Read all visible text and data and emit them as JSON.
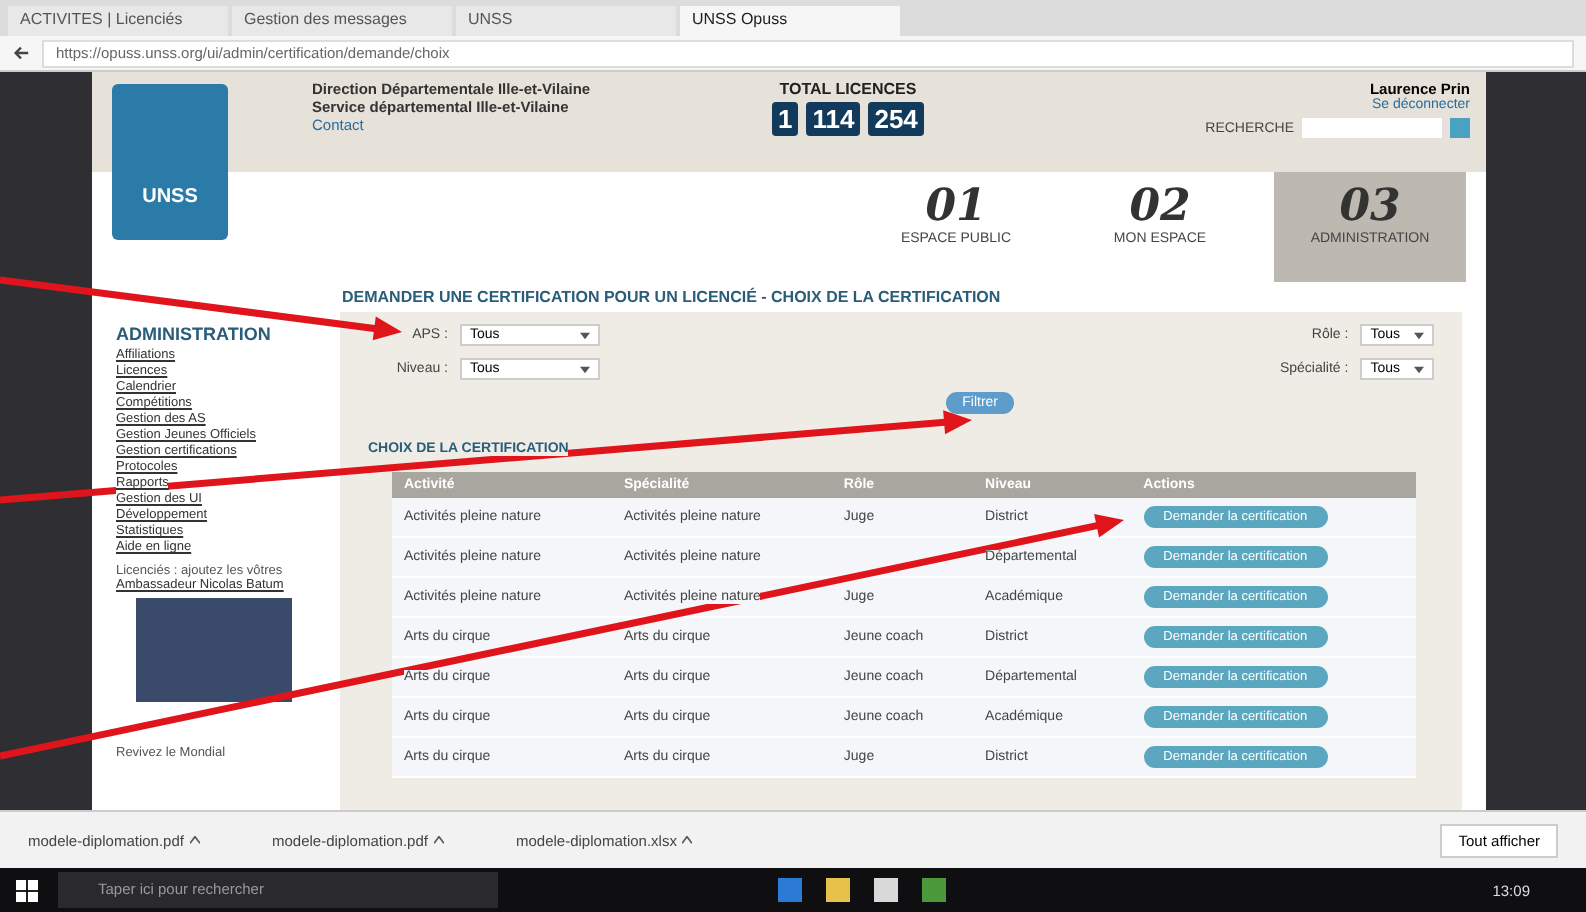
{
  "browser": {
    "tabs": [
      {
        "label": "ACTIVITES | Licenciés",
        "selected": false
      },
      {
        "label": "Gestion des messages",
        "selected": false
      },
      {
        "label": "UNSS",
        "selected": false
      },
      {
        "label": "UNSS Opuss",
        "selected": true
      }
    ],
    "url": "https://opuss.unss.org/ui/admin/certification/demande/choix"
  },
  "header": {
    "lines": [
      "Direction Départementale Ille-et-Vilaine",
      "Service départemental Ille-et-Vilaine",
      "Contact"
    ],
    "logo": "UNSS",
    "total_label": "TOTAL LICENCES",
    "total_digits": [
      "1",
      "114",
      "254"
    ],
    "user": "Laurence Prin",
    "logout": "Se déconnecter",
    "search_label": "RECHERCHE"
  },
  "spaces": [
    {
      "number": "01",
      "label": "ESPACE PUBLIC",
      "selected": false
    },
    {
      "number": "02",
      "label": "MON ESPACE",
      "selected": false
    },
    {
      "number": "03",
      "label": "ADMINISTRATION",
      "selected": true
    }
  ],
  "page_title": "DEMANDER UNE CERTIFICATION POUR UN LICENCIÉ - CHOIX DE LA CERTIFICATION",
  "sidebar": {
    "title": "ADMINISTRATION",
    "items": [
      "Affiliations",
      "Licences",
      "Calendrier",
      "Compétitions",
      "Gestion des AS",
      "Gestion Jeunes Officiels",
      "Gestion certifications",
      "Protocoles",
      "Rapports",
      "Gestion des UI",
      "Développement",
      "Statistiques",
      "Aide en ligne"
    ],
    "caption": "Licenciés : ajoutez les vôtres",
    "caption_link": "Ambassadeur Nicolas Batum",
    "footer": "Revivez le Mondial"
  },
  "filters": [
    {
      "label": "APS :",
      "value": "Tous"
    },
    {
      "label": "Rôle :",
      "value": "Tous"
    },
    {
      "label": "Niveau :",
      "value": "Tous"
    },
    {
      "label": "Spécialité :",
      "value": "Tous"
    }
  ],
  "filter_button": "Filtrer",
  "section_title": "CHOIX DE LA CERTIFICATION",
  "table": {
    "columns": [
      "Activité",
      "Spécialité",
      "Rôle",
      "Niveau",
      "Actions"
    ],
    "rows": [
      {
        "cells": [
          "Activités pleine nature",
          "Activités pleine nature",
          "Juge",
          "District"
        ],
        "action": "Demander la certification"
      },
      {
        "cells": [
          "Activités pleine nature",
          "Activités pleine nature",
          "",
          "Départemental"
        ],
        "action": "Demander la certification"
      },
      {
        "cells": [
          "Activités pleine nature",
          "Activités pleine nature",
          "Juge",
          "Académique"
        ],
        "action": "Demander la certification"
      },
      {
        "cells": [
          "Arts du cirque",
          "Arts du cirque",
          "Jeune coach",
          "District"
        ],
        "action": "Demander la certification"
      },
      {
        "cells": [
          "Arts du cirque",
          "Arts du cirque",
          "Jeune coach",
          "Départemental"
        ],
        "action": "Demander la certification"
      },
      {
        "cells": [
          "Arts du cirque",
          "Arts du cirque",
          "Jeune coach",
          "Académique"
        ],
        "action": "Demander la certification"
      },
      {
        "cells": [
          "Arts du cirque",
          "Arts du cirque",
          "Juge",
          "District"
        ],
        "action": "Demander la certification"
      }
    ]
  },
  "downloads": {
    "items": [
      "modele-diplomation.pdf",
      "modele-diplomation.pdf",
      "modele-diplomation.xlsx"
    ],
    "show_all": "Tout afficher"
  },
  "taskbar": {
    "search": "Taper ici pour rechercher",
    "time": "13:09"
  }
}
